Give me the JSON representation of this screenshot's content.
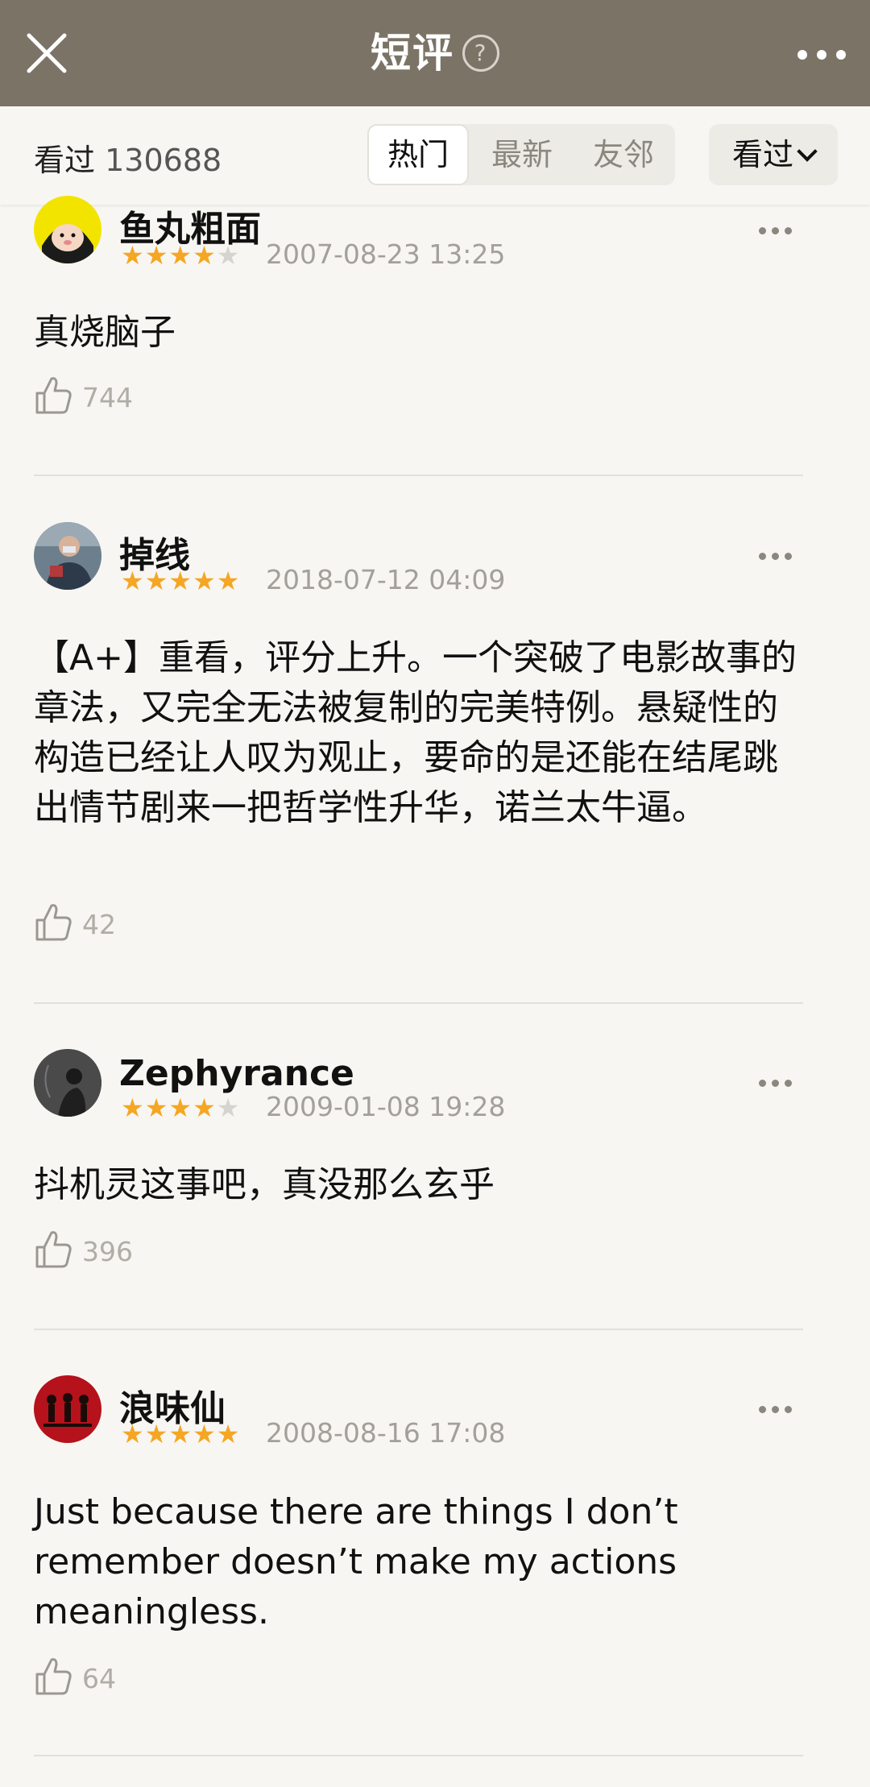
{
  "header": {
    "title": "短评",
    "help_glyph": "?"
  },
  "filter": {
    "seen_label": "看过",
    "seen_count": "130688",
    "tabs": [
      "热门",
      "最新",
      "友邻"
    ],
    "active_tab": "热门",
    "dropdown_label": "看过"
  },
  "reviews": [
    {
      "user": "鱼丸粗面",
      "rating": 4,
      "date": "2007-08-23 13:25",
      "text": "真烧脑子",
      "likes": "744"
    },
    {
      "user": "掉线",
      "rating": 5,
      "date": "2018-07-12 04:09",
      "text": "【A+】重看，评分上升。一个突破了电影故事的章法，又完全无法被复制的完美特例。悬疑性的构造已经让人叹为观止，要命的是还能在结尾跳出情节剧来一把哲学性升华，诺兰太牛逼。",
      "likes": "42"
    },
    {
      "user": "Zephyrance",
      "rating": 4,
      "date": "2009-01-08 19:28",
      "text": "抖机灵这事吧，真没那么玄乎",
      "likes": "396"
    },
    {
      "user": "浪味仙",
      "rating": 5,
      "date": "2008-08-16 17:08",
      "text": "Just because there are things I don’t remember doesn’t make my actions meaningless.",
      "likes": "64"
    }
  ],
  "colors": {
    "header_bg": "#7b7366",
    "star_on": "#f5a623",
    "star_off": "#d6d4cf"
  },
  "icons": [
    "close-icon",
    "help-icon",
    "more-icon",
    "chevron-down-icon",
    "thumbs-up-icon"
  ]
}
